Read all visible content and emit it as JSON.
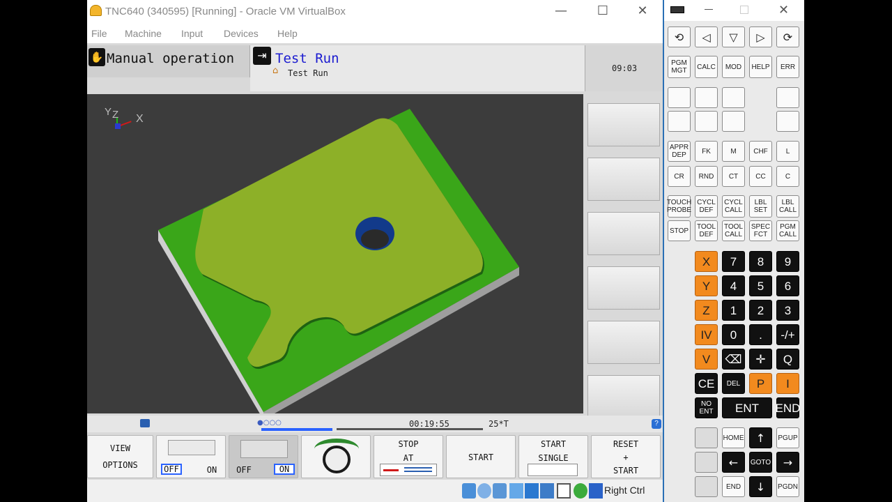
{
  "window": {
    "title": "TNC640 (340595) [Running] - Oracle VM VirtualBox",
    "minimize": "—",
    "maximize": "☐",
    "close": "✕"
  },
  "menu": [
    "File",
    "Machine",
    "Input",
    "Devices",
    "Help"
  ],
  "modes": {
    "left": "Manual operation",
    "right_title": "Test Run",
    "right_sub": "Test Run",
    "clock": "09:03"
  },
  "axis": {
    "y": "Y",
    "z": "Z",
    "x": "X"
  },
  "status": {
    "time": "00:19:55",
    "temp": "25*T",
    "help": "?"
  },
  "softkeys": {
    "view_options": [
      "VIEW",
      "OPTIONS"
    ],
    "toggle1": {
      "off": "OFF",
      "on": "ON",
      "active": "off"
    },
    "toggle2": {
      "off": "OFF",
      "on": "ON",
      "active": "on"
    },
    "stop_at": [
      "STOP",
      "AT"
    ],
    "start": "START",
    "start_single": [
      "START",
      "SINGLE"
    ],
    "reset_start": [
      "RESET",
      "+",
      "START"
    ]
  },
  "host": {
    "right_ctrl": "Right Ctrl"
  },
  "panel": {
    "row1": [
      "⟲",
      "◁",
      "▽",
      "▷",
      "⟳"
    ],
    "row2": [
      "PGM MGT",
      "CALC",
      "MOD",
      "HELP",
      "ERR"
    ],
    "row5": [
      "APPR DEP",
      "FK",
      "M",
      "CHF",
      "L"
    ],
    "row6": [
      "CR",
      "RND",
      "CT",
      "CC",
      "C"
    ],
    "row7": [
      "TOUCH PROBE",
      "CYCL DEF",
      "CYCL CALL",
      "LBL SET",
      "LBL CALL"
    ],
    "row8": [
      "STOP",
      "TOOL DEF",
      "TOOL CALL",
      "SPEC FCT",
      "PGM CALL"
    ],
    "axes": [
      "X",
      "Y",
      "Z",
      "IV",
      "V"
    ],
    "nums": [
      [
        "7",
        "8",
        "9"
      ],
      [
        "4",
        "5",
        "6"
      ],
      [
        "1",
        "2",
        "3"
      ],
      [
        "0",
        ".",
        "-/+"
      ]
    ],
    "row_q": [
      "⌫",
      "✛",
      "Q"
    ],
    "row_ce": [
      "CE",
      "DEL",
      "P",
      "I"
    ],
    "row_ent": [
      "NO ENT",
      "ENT",
      "END"
    ],
    "nav": [
      "HOME",
      "PGUP",
      "GOTO",
      "END",
      "PGDN"
    ]
  }
}
